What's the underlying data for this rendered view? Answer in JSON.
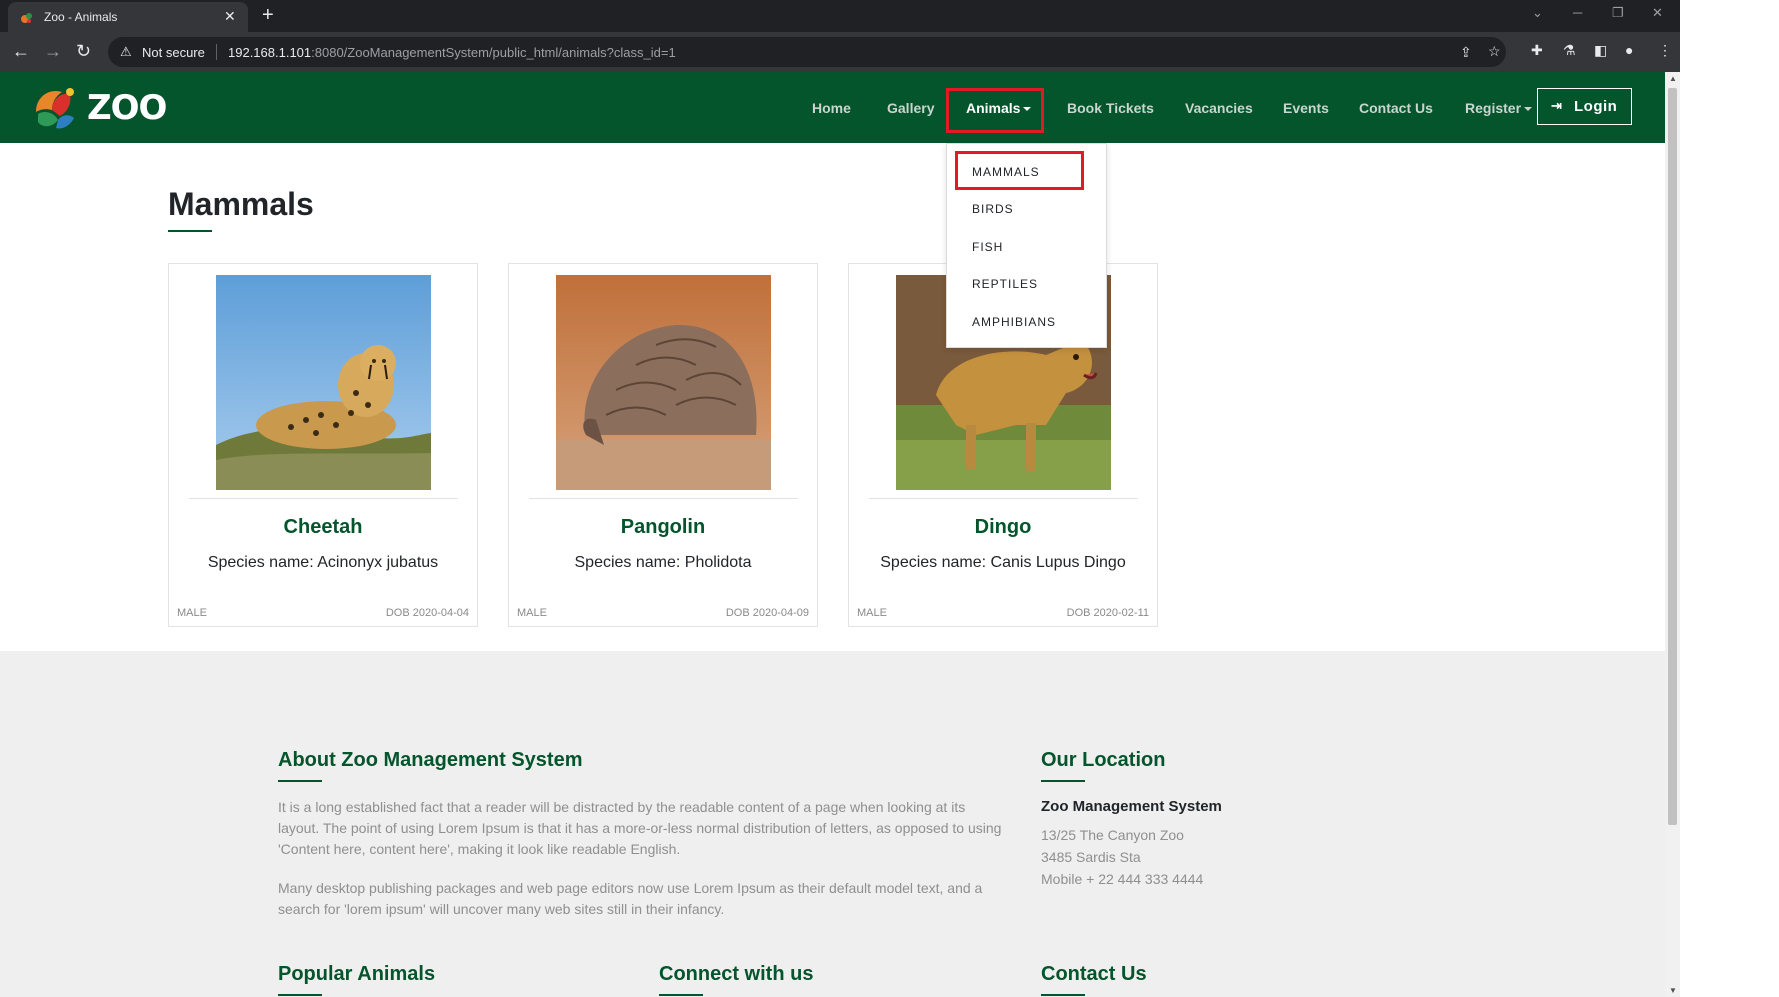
{
  "browser": {
    "tab_title": "Zoo - Animals",
    "tab_close": "✕",
    "new_tab": "+",
    "security_label": "Not secure",
    "url_host": "192.168.1.101",
    "url_rest": ":8080/ZooManagementSystem/public_html/animals?class_id=1"
  },
  "site": {
    "logo_text": "ZOO",
    "nav": {
      "home": "Home",
      "gallery": "Gallery",
      "animals": "Animals",
      "book_tickets": "Book Tickets",
      "vacancies": "Vacancies",
      "events": "Events",
      "contact_us": "Contact Us",
      "register": "Register",
      "login": "Login"
    },
    "animals_menu": [
      "MAMMALS",
      "BIRDS",
      "FISH",
      "REPTILES",
      "AMPHIBIANS"
    ]
  },
  "page": {
    "title": "Mammals",
    "cards": [
      {
        "name": "Cheetah",
        "species": "Species name: Acinonyx jubatus",
        "sex": "MALE",
        "dob": "DOB 2020-04-04"
      },
      {
        "name": "Pangolin",
        "species": "Species name: Pholidota",
        "sex": "MALE",
        "dob": "DOB 2020-04-09"
      },
      {
        "name": "Dingo",
        "species": "Species name: Canis Lupus Dingo",
        "sex": "MALE",
        "dob": "DOB 2020-02-11"
      }
    ]
  },
  "footer": {
    "about_heading": "About Zoo Management System",
    "about_p1": "It is a long established fact that a reader will be distracted by the readable content of a page when looking at its layout. The point of using Lorem Ipsum is that it has a more-or-less normal distribution of letters, as opposed to using 'Content here, content here', making it look like readable English.",
    "about_p2": "Many desktop publishing packages and web page editors now use Lorem Ipsum as their default model text, and a search for 'lorem ipsum' will uncover many web sites still in their infancy.",
    "location_heading": "Our Location",
    "location_name": "Zoo Management System",
    "address_1": "13/25 The Canyon Zoo",
    "address_2": "3485 Sardis Sta",
    "mobile": "Mobile + 22 444 333 4444",
    "popular_heading": "Popular Animals",
    "connect_heading": "Connect with us",
    "contact_heading": "Contact Us"
  },
  "colors": {
    "brand_green": "#04542c",
    "highlight_red": "#e01b24",
    "footer_bg": "#efefef"
  }
}
